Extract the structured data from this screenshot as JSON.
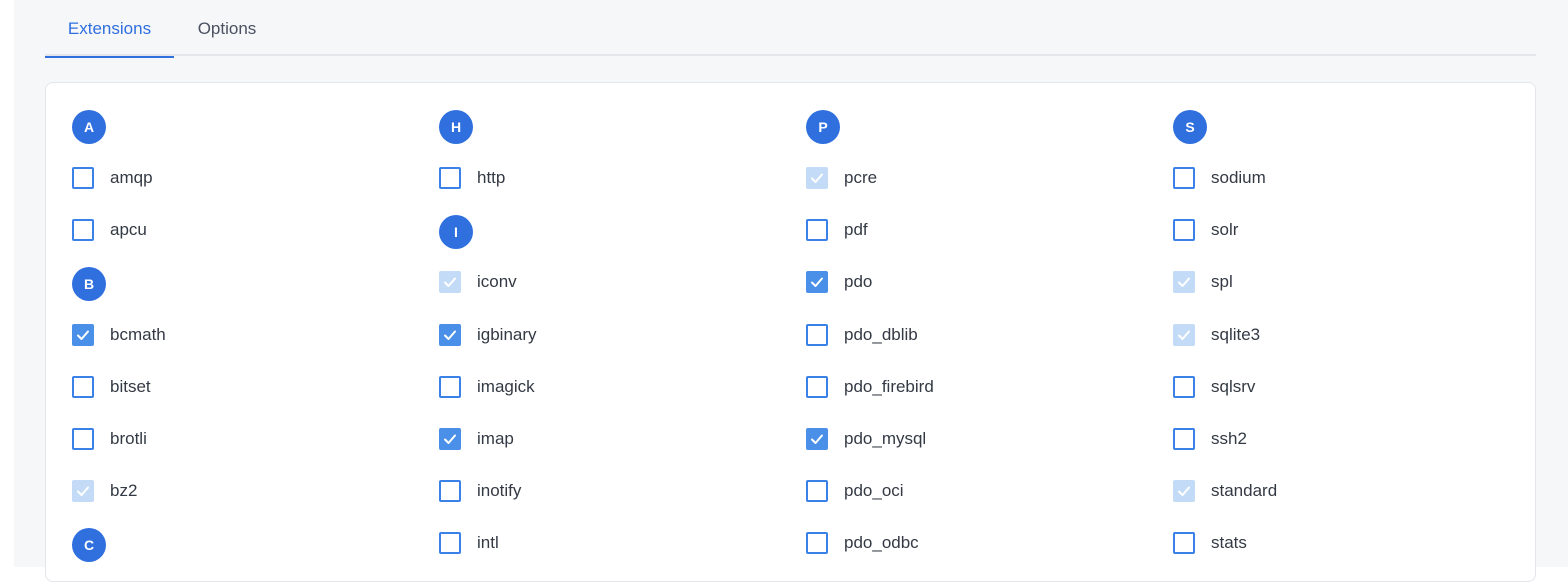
{
  "tabs": [
    {
      "label": "Extensions",
      "active": true
    },
    {
      "label": "Options",
      "active": false
    }
  ],
  "colors": {
    "accent": "#2f6fde",
    "checked": "#4a90e8",
    "disabled": "#c3dbf6"
  },
  "columns": [
    {
      "entries": [
        {
          "type": "letter",
          "label": "A"
        },
        {
          "type": "item",
          "label": "amqp",
          "state": "unchecked"
        },
        {
          "type": "item",
          "label": "apcu",
          "state": "unchecked"
        },
        {
          "type": "letter",
          "label": "B"
        },
        {
          "type": "item",
          "label": "bcmath",
          "state": "checked"
        },
        {
          "type": "item",
          "label": "bitset",
          "state": "unchecked"
        },
        {
          "type": "item",
          "label": "brotli",
          "state": "unchecked"
        },
        {
          "type": "item",
          "label": "bz2",
          "state": "disabled"
        },
        {
          "type": "letter",
          "label": "C"
        }
      ]
    },
    {
      "entries": [
        {
          "type": "letter",
          "label": "H"
        },
        {
          "type": "item",
          "label": "http",
          "state": "unchecked"
        },
        {
          "type": "letter",
          "label": "I"
        },
        {
          "type": "item",
          "label": "iconv",
          "state": "disabled"
        },
        {
          "type": "item",
          "label": "igbinary",
          "state": "checked"
        },
        {
          "type": "item",
          "label": "imagick",
          "state": "unchecked"
        },
        {
          "type": "item",
          "label": "imap",
          "state": "checked"
        },
        {
          "type": "item",
          "label": "inotify",
          "state": "unchecked"
        },
        {
          "type": "item",
          "label": "intl",
          "state": "unchecked"
        }
      ]
    },
    {
      "entries": [
        {
          "type": "letter",
          "label": "P"
        },
        {
          "type": "item",
          "label": "pcre",
          "state": "disabled"
        },
        {
          "type": "item",
          "label": "pdf",
          "state": "unchecked"
        },
        {
          "type": "item",
          "label": "pdo",
          "state": "checked"
        },
        {
          "type": "item",
          "label": "pdo_dblib",
          "state": "unchecked"
        },
        {
          "type": "item",
          "label": "pdo_firebird",
          "state": "unchecked"
        },
        {
          "type": "item",
          "label": "pdo_mysql",
          "state": "checked"
        },
        {
          "type": "item",
          "label": "pdo_oci",
          "state": "unchecked"
        },
        {
          "type": "item",
          "label": "pdo_odbc",
          "state": "unchecked"
        }
      ]
    },
    {
      "entries": [
        {
          "type": "letter",
          "label": "S"
        },
        {
          "type": "item",
          "label": "sodium",
          "state": "unchecked"
        },
        {
          "type": "item",
          "label": "solr",
          "state": "unchecked"
        },
        {
          "type": "item",
          "label": "spl",
          "state": "disabled"
        },
        {
          "type": "item",
          "label": "sqlite3",
          "state": "disabled"
        },
        {
          "type": "item",
          "label": "sqlsrv",
          "state": "unchecked"
        },
        {
          "type": "item",
          "label": "ssh2",
          "state": "unchecked"
        },
        {
          "type": "item",
          "label": "standard",
          "state": "disabled"
        },
        {
          "type": "item",
          "label": "stats",
          "state": "unchecked"
        }
      ]
    }
  ]
}
